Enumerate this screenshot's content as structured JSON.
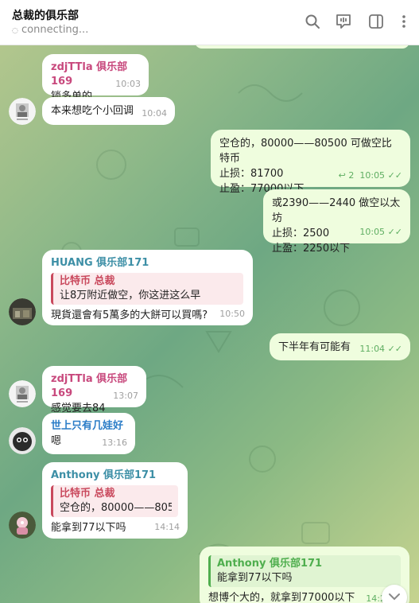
{
  "header": {
    "title": "总裁的俱乐部",
    "status": "connecting...",
    "icons": [
      "search-icon",
      "live-chat-icon",
      "sidebar-toggle-icon",
      "more-vertical-icon"
    ]
  },
  "colors": {
    "incoming_bubble": "#ffffff",
    "outgoing_bubble": "#effdde",
    "sender_pink": "#c8497d",
    "sender_teal": "#3d8fa6",
    "sender_blue": "#2a7cc7",
    "reply_red": "#c9495d",
    "reply_green": "#4fae4e",
    "check_green": "#5fae62"
  },
  "messages": [
    {
      "sender": "zdjTTla 俱乐部169",
      "text": "锁多单的",
      "time": "10:03"
    },
    {
      "text": "本来想吃个小回调",
      "time": "10:04"
    },
    {
      "text": "空仓的，80000——80500 可做空比特币\n止损：81700\n止盈：77000以下",
      "replies": "2",
      "time": "10:05"
    },
    {
      "text": "或2390——2440 做空以太坊\n止损：2500\n止盈：2250以下",
      "time": "10:05"
    },
    {
      "sender": "HUANG 俱乐部171",
      "reply_name": "比特币 总裁",
      "reply_text": "让8万附近做空，你这进这么早",
      "text": "現貨還會有5萬多的大餅可以買嗎?",
      "time": "10:50"
    },
    {
      "text": "下半年有可能有",
      "time": "11:04"
    },
    {
      "sender": "zdjTTla 俱乐部169",
      "text": "感觉要去84",
      "time": "13:07"
    },
    {
      "sender": "世上只有几娃好",
      "text": "嗯",
      "time": "13:16"
    },
    {
      "sender": "Anthony 俱乐部171",
      "reply_name": "比特币 总裁",
      "reply_text": "空仓的，80000——805...",
      "text": "能拿到77以下吗",
      "time": "14:14"
    },
    {
      "reply_name": "Anthony 俱乐部171",
      "reply_text": "能拿到77以下吗",
      "text": "想博个大的，就拿到77000以下",
      "time": "14:2"
    }
  ]
}
